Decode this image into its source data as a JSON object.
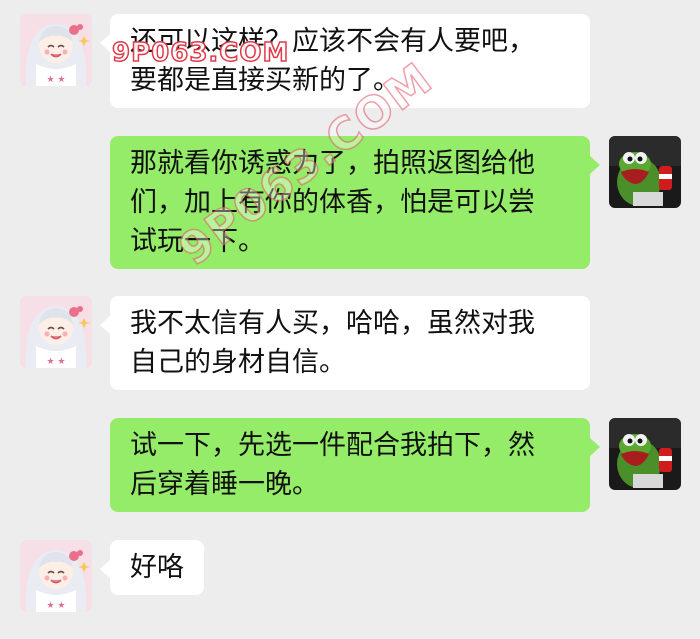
{
  "conversation": {
    "messages": [
      {
        "sender": "other",
        "lines": [
          "还可以这样？应该不会有人要吧，",
          "要都是直接买新的了。"
        ]
      },
      {
        "sender": "me",
        "lines": [
          "那就看你诱惑力了，拍照返图给他",
          "们，加上有你的体香，怕是可以尝",
          "试玩一下。"
        ]
      },
      {
        "sender": "other",
        "lines": [
          "我不太信有人买，哈哈，虽然对我",
          "自己的身材自信。"
        ]
      },
      {
        "sender": "me",
        "lines": [
          "试一下，先选一件配合我拍下，然",
          "后穿着睡一晚。"
        ]
      },
      {
        "sender": "other",
        "lines": [
          "好咯"
        ]
      }
    ]
  },
  "watermarks": {
    "top": "9P063.COM",
    "diagonal": "9P063.COM"
  },
  "colors": {
    "background": "#ededed",
    "bubble_me": "#95ec69",
    "bubble_other": "#ffffff"
  },
  "icons": {
    "other_avatar": "anime-girl-avatar-icon",
    "me_avatar": "green-frog-avatar-icon"
  }
}
